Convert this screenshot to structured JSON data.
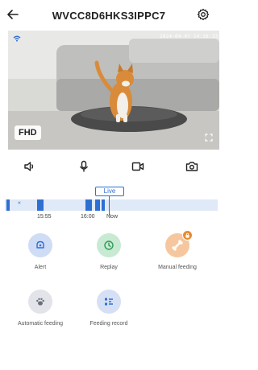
{
  "header": {
    "title": "WVCC8D6HKS3IPPC7",
    "back_icon": "arrow-left-icon",
    "settings_icon": "gear-icon"
  },
  "video": {
    "timestamp": "2024-04-07 14:26:33",
    "quality": "FHD",
    "wifi_icon": "wifi-icon",
    "fullscreen_icon": "fullscreen-icon"
  },
  "controls": [
    {
      "name": "speaker-icon"
    },
    {
      "name": "microphone-icon"
    },
    {
      "name": "record-icon"
    },
    {
      "name": "snapshot-icon"
    }
  ],
  "timeline": {
    "live_label": "Live",
    "rewind_label": "«",
    "time_labels": [
      "15:55",
      "16:00",
      "Now"
    ]
  },
  "actions": {
    "alert": {
      "label": "Alert",
      "icon": "bell-icon",
      "color": "#cfdcf6"
    },
    "replay": {
      "label": "Replay",
      "icon": "replay-icon",
      "color": "#c8ead2"
    },
    "manual_feeding": {
      "label": "Manual feeding",
      "icon": "bone-icon",
      "color": "#f6c79e",
      "badge_icon": "lock-icon"
    },
    "automatic_feeding": {
      "label": "Automatic feeding",
      "icon": "paw-icon",
      "color": "#e2e4ea"
    },
    "feeding_record": {
      "label": "Feeding record",
      "icon": "list-icon",
      "color": "#d6e0f5"
    }
  },
  "colors": {
    "accent": "#2f6fd3",
    "timeline_bg": "#dfe9f7"
  }
}
